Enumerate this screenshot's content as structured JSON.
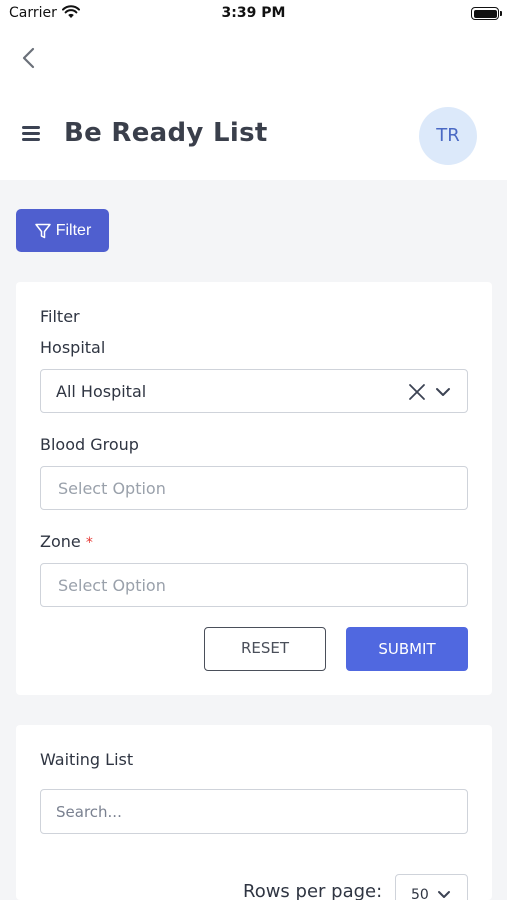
{
  "status_bar": {
    "carrier": "Carrier",
    "time": "3:39 PM"
  },
  "header": {
    "title": "Be Ready List",
    "avatar_initials": "TR"
  },
  "icons": {
    "back": "chevron-left-icon",
    "menu": "hamburger-menu-icon",
    "filter": "funnel-icon",
    "clear": "close-icon",
    "dropdown": "chevron-down-icon"
  },
  "colors": {
    "primary": "#4f5fcf",
    "submit": "#5068e0",
    "avatar_bg": "#dce9fa",
    "required": "#e53935"
  },
  "filter_button": {
    "label": "Filter"
  },
  "filter_card": {
    "title": "Filter",
    "hospital": {
      "label": "Hospital",
      "value": "All Hospital"
    },
    "blood_group": {
      "label": "Blood Group",
      "placeholder": "Select Option"
    },
    "zone": {
      "label": "Zone",
      "required_mark": "*",
      "placeholder": "Select Option"
    },
    "reset_label": "RESET",
    "submit_label": "SUBMIT"
  },
  "waiting_list": {
    "title": "Waiting List",
    "search_placeholder": "Search...",
    "rows_per_page_label": "Rows per page:",
    "rows_per_page_value": "50"
  }
}
